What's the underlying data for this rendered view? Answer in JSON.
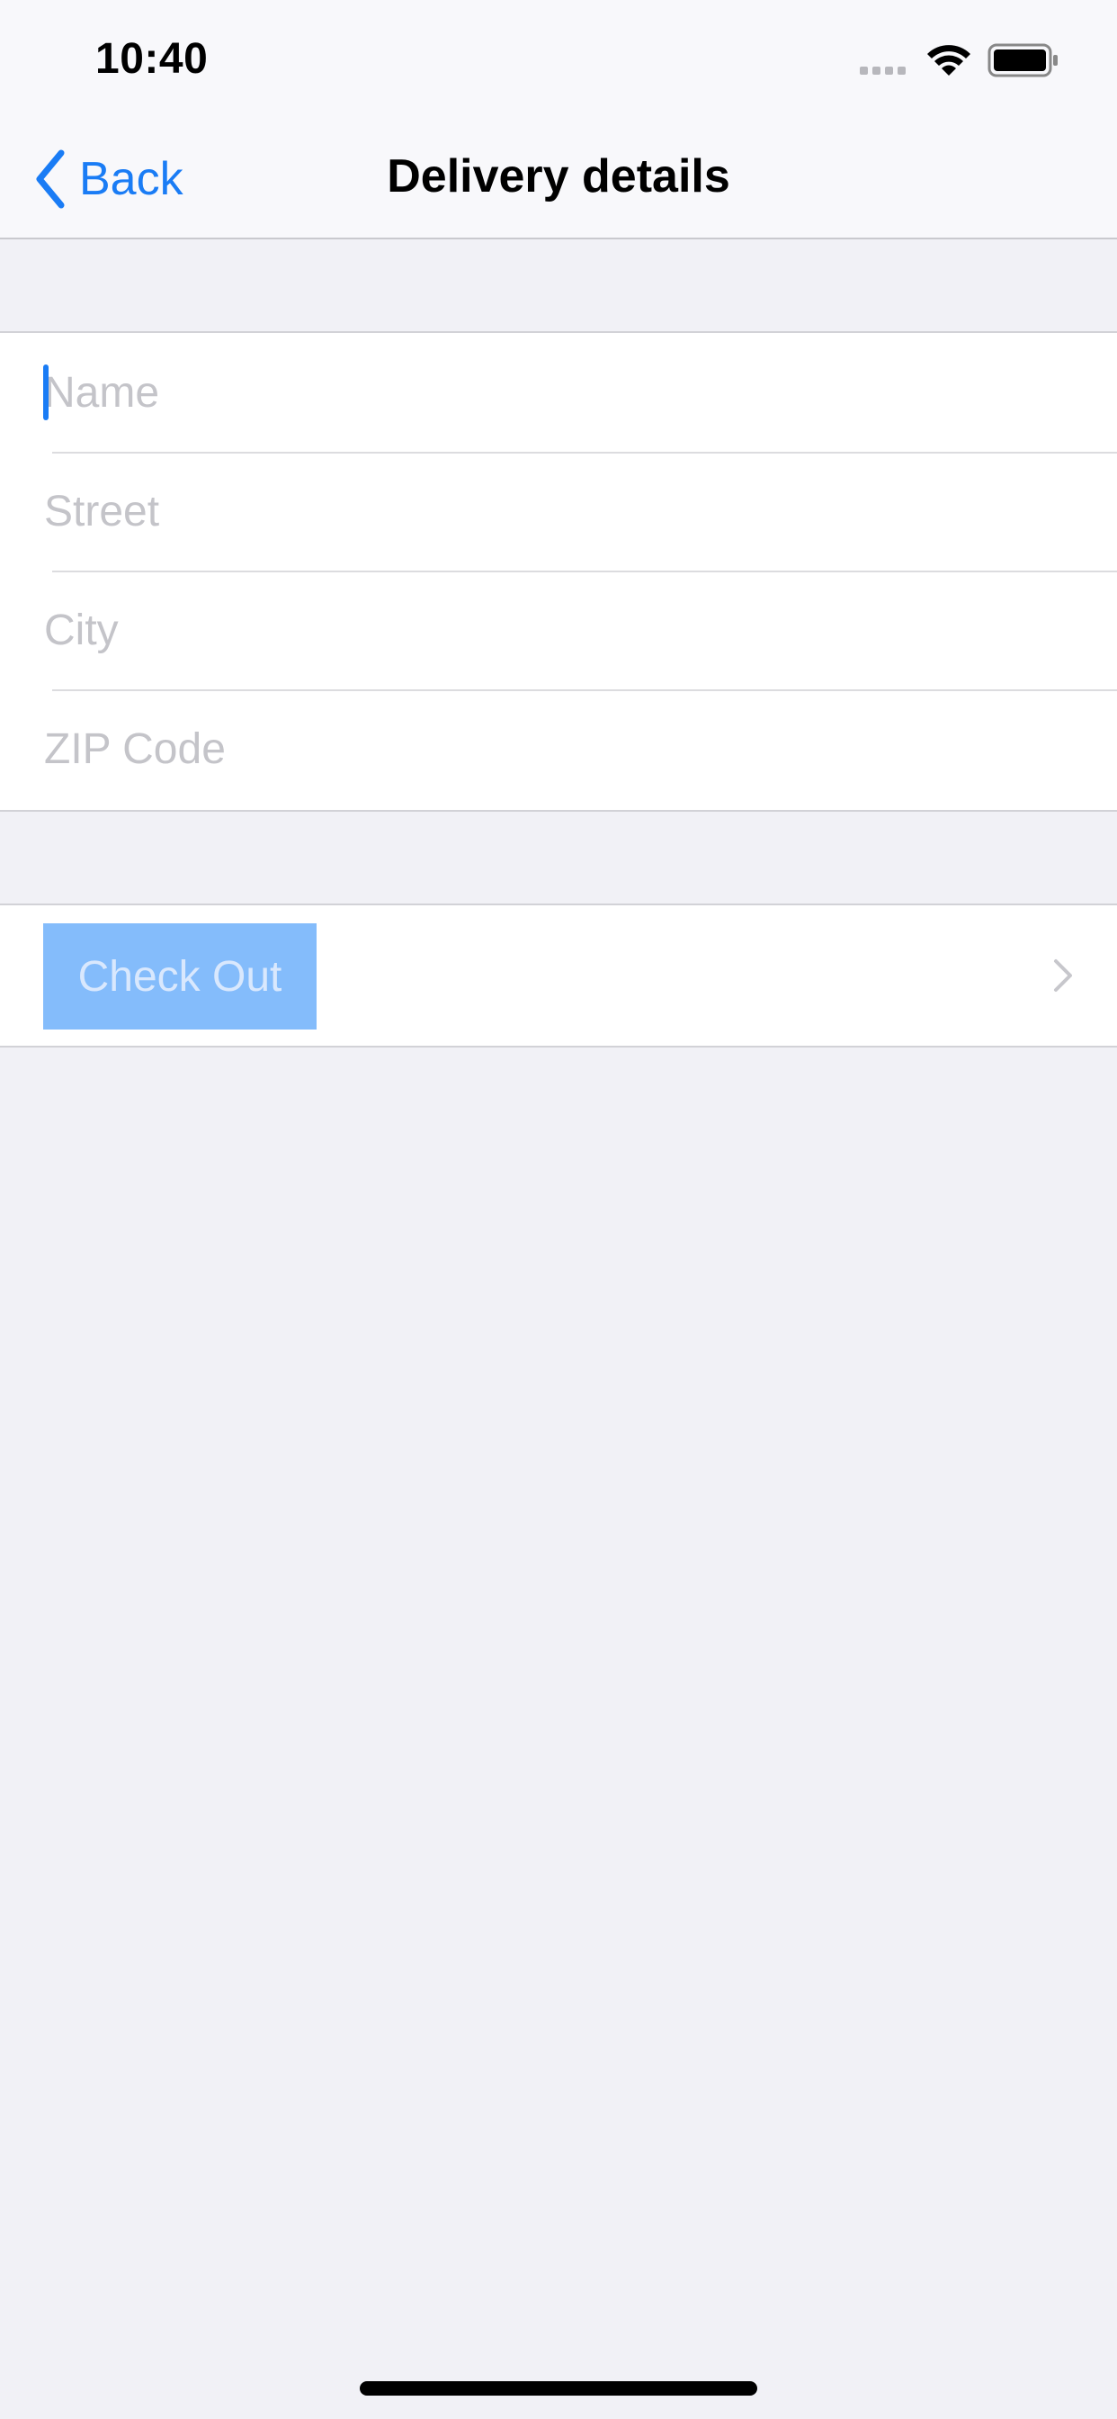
{
  "status_bar": {
    "time": "10:40",
    "signal_icon": "cellular-signal-icon",
    "wifi_icon": "wifi-icon",
    "battery_icon": "battery-icon"
  },
  "nav": {
    "back_label": "Back",
    "back_icon": "chevron-left-icon",
    "title": "Delivery details"
  },
  "form": {
    "fields": [
      {
        "placeholder": "Name",
        "value": ""
      },
      {
        "placeholder": "Street",
        "value": ""
      },
      {
        "placeholder": "City",
        "value": ""
      },
      {
        "placeholder": "ZIP Code",
        "value": ""
      }
    ]
  },
  "checkout": {
    "label": "Check Out",
    "chevron_icon": "chevron-right-icon"
  },
  "colors": {
    "accent": "#1a7cf5",
    "background": "#f1f1f6",
    "placeholder": "#c4c4c9",
    "button_disabled_bg": "#84bcfb"
  }
}
